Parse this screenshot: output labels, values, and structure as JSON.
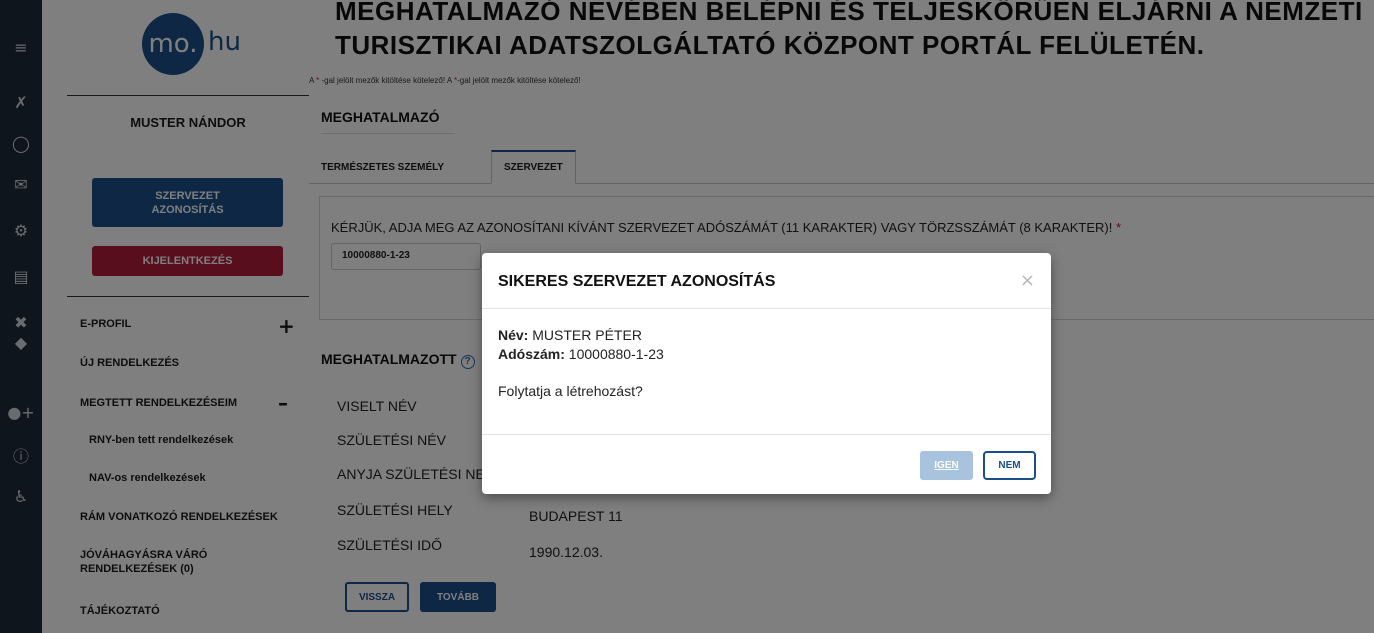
{
  "rail": {
    "icons": [
      "menu-icon",
      "tools-off-icon",
      "user-icon",
      "mail-icon",
      "gear-icon",
      "card-icon",
      "wrench-icon",
      "shield-icon",
      "add-user-icon",
      "help-icon",
      "accessibility-icon"
    ]
  },
  "sidebar": {
    "logo_text": "mo.",
    "logo_suffix": "hu",
    "user_name": "MUSTER NÁNDOR",
    "org_button": "SZERVEZET AZONOSÍTÁS",
    "logout_button": "KIJELENTKEZÉS",
    "nav": {
      "eprofil": "E-PROFIL",
      "uj": "ÚJ RENDELKEZÉS",
      "megtett": "MEGTETT RENDELKEZÉSEIM",
      "rny": "RNY-ben tett rendelkezések",
      "nav": "NAV-os rendelkezések",
      "ram": "RÁM VONATKOZÓ RENDELKEZÉSEK",
      "jovahagy": "JÓVÁHAGYÁSRA VÁRÓ RENDELKEZÉSEK (0)",
      "tajekoztato": "TÁJÉKOZTATÓ"
    },
    "plus_sign": "+",
    "minus_sign": "–"
  },
  "main": {
    "title_line1": "MEGHATALMAZÓ NEVÉBEN BELÉPNI ÉS TELJESKÖRŰEN ELJÁRNI A NEMZETI",
    "title_line2": "TURISZTIKAI ADATSZOLGÁLTATÓ KÖZPONT PORTÁL FELÜLETÉN.",
    "required_note_a": "A ",
    "required_star": "*",
    "required_note_b": " -gal jelölt mezők kitöltése kötelező! A ",
    "required_note_c": "-gal jelölt mezők kitöltése kötelező!",
    "meghatalmazo": "MEGHATALMAZÓ",
    "tab_natural": "TERMÉSZETES SZEMÉLY",
    "tab_org": "SZERVEZET",
    "question": "KÉRJÜK, ADJA MEG AZ AZONOSÍTANI KÍVÁNT SZERVEZET ADÓSZÁMÁT (11 KARAKTER) VAGY TÖRZSSZÁMÁT (8 KARAKTER)!",
    "tax_value": "10000880-1-23",
    "meghatalmazott": "MEGHATALMAZOTT",
    "help_glyph": "?",
    "fields": [
      {
        "label": "VISELT NÉV",
        "value": ""
      },
      {
        "label": "SZÜLETÉSI NÉV",
        "value": ""
      },
      {
        "label": "ANYJA SZÜLETÉSI NEVE",
        "value": ""
      },
      {
        "label": "SZÜLETÉSI HELY",
        "value": "BUDAPEST 11"
      },
      {
        "label": "SZÜLETÉSI IDŐ",
        "value": "1990.12.03."
      }
    ],
    "back_button": "VISSZA",
    "next_button": "TOVÁBB"
  },
  "modal": {
    "title": "SIKERES SZERVEZET AZONOSÍTÁS",
    "close": "×",
    "name_label": "Név:",
    "name_value": "MUSTER PÉTER",
    "tax_label": "Adószám:",
    "tax_value": "10000880-1-23",
    "question": "Folytatja a létrehozást?",
    "yes": "IGEN",
    "no": "NEM"
  }
}
